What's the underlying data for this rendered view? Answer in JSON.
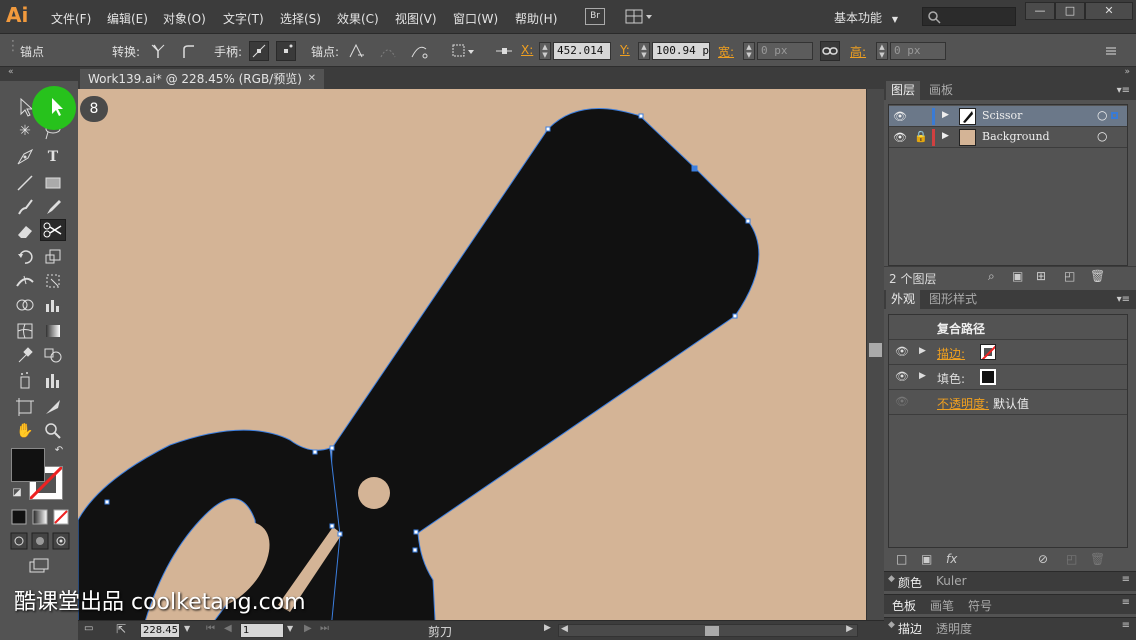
{
  "app": {
    "logo": "Ai"
  },
  "menu": [
    "文件(F)",
    "编辑(E)",
    "对象(O)",
    "文字(T)",
    "选择(S)",
    "效果(C)",
    "视图(V)",
    "窗口(W)",
    "帮助(H)"
  ],
  "bridge_label": "Br",
  "workspace": "基本功能",
  "control": {
    "selection_label": "锚点",
    "convert_label": "转换:",
    "handles_label": "手柄:",
    "anchors_label": "锚点:",
    "x_label": "X:",
    "x_value": "452.014 p",
    "y_label": "Y:",
    "y_value": "100.94 px",
    "w_label": "宽:",
    "w_value": "0 px",
    "h_label": "高:",
    "h_value": "0 px"
  },
  "document": {
    "tab_title": "Work139.ai* @ 228.45% (RGB/预览)",
    "zoom": "228.45",
    "page": "1",
    "status_tool": "剪刀",
    "canvas_color": "#d4b496"
  },
  "step_badge": "8",
  "watermark": "酷课堂出品 coolketang.com",
  "layers_panel": {
    "tabs": [
      "图层",
      "画板"
    ],
    "layers": [
      {
        "name": "Scissor",
        "color": "#3a7bd5",
        "selected": true
      },
      {
        "name": "Background",
        "color": "#d04040",
        "selected": false
      }
    ],
    "count": "2 个图层"
  },
  "appearance_panel": {
    "tabs": [
      "外观",
      "图形样式"
    ],
    "title": "复合路径",
    "stroke_label": "描边:",
    "fill_label": "填色:",
    "opacity_label": "不透明度:",
    "opacity_value": "默认值"
  },
  "collapsed_panels": [
    {
      "tabs": [
        "颜色",
        "Kuler"
      ]
    },
    {
      "tabs": [
        "色板",
        "画笔",
        "符号"
      ]
    },
    {
      "tabs": [
        "描边",
        "透明度"
      ]
    }
  ]
}
